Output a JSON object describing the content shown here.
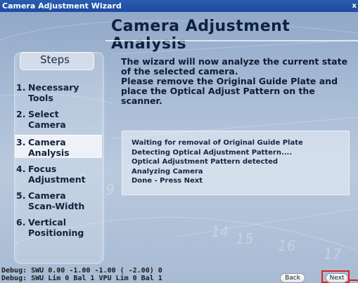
{
  "window": {
    "title": "Camera Adjustment Wizard",
    "close_glyph": "x"
  },
  "header": {
    "title": "Camera Adjustment Analysis"
  },
  "steps": {
    "heading": "Steps",
    "items": [
      {
        "num": "1.",
        "line1": "Necessary",
        "line2": "Tools"
      },
      {
        "num": "2.",
        "line1": "Select",
        "line2": "Camera"
      },
      {
        "num": "3.",
        "line1": "Camera",
        "line2": "Analysis"
      },
      {
        "num": "4.",
        "line1": "Focus",
        "line2": "Adjustment"
      },
      {
        "num": "5.",
        "line1": "Camera",
        "line2": "Scan-Width"
      },
      {
        "num": "6.",
        "line1": "Vertical",
        "line2": "Positioning"
      }
    ],
    "active_index": 2
  },
  "instructions": [
    "The wizard will now analyze the current state",
    "of the selected camera.",
    "Please remove the Original Guide Plate and",
    "place the Optical Adjust Pattern on the",
    "scanner."
  ],
  "status_lines": [
    "Waiting for removal of Original Guide Plate",
    "Detecting Optical Adjustment Pattern....",
    "Optical Adjustment Pattern detected",
    "Analyzing Camera",
    "Done - Press Next"
  ],
  "debug": {
    "line1": "Debug: SWU  0.00  -1.00  -1.00  ( -2.00) 0",
    "line2": "Debug: SWU Lim 0  Bal 1  VPU Lim 0  Bal 1"
  },
  "buttons": {
    "back_label": "Back",
    "next_label": "Next"
  },
  "colors": {
    "highlight": "#e0201c",
    "titlebar": "#1c4aa0"
  }
}
